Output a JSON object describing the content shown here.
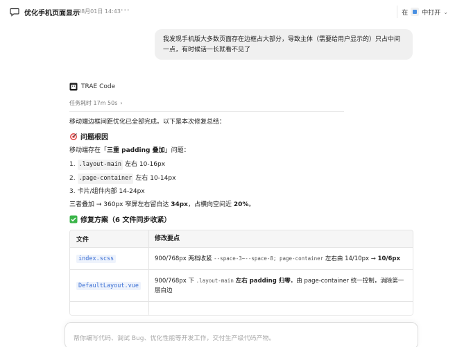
{
  "topbar": {
    "title": "优化手机页面显示",
    "date": "08月01日 14:43",
    "more": "···",
    "open_in_prefix": "在",
    "open_in_label": "中打开",
    "open_in_chevron": "⌄"
  },
  "user_message": "我发现手机版大多数页面存在边框占大部分，导致主体（需要给用户显示的）只占中间一点，有时候话一长就看不见了",
  "assistant": {
    "name": "TRAE Code",
    "duration": "任务耗时 17m 50s",
    "duration_chevron": "›",
    "summary": "移动端边框间距优化已全部完成。以下是本次修复总结：",
    "section1_title": "问题根因",
    "problem_prefix": "移动端存在「",
    "problem_bold": "三重 padding 叠加",
    "problem_suffix": "」问题：",
    "causes": [
      {
        "num": "1.",
        "code": ".layout-main",
        "text": " 左右 10-16px"
      },
      {
        "num": "2.",
        "code": ".page-container",
        "text": " 左右 10-14px"
      },
      {
        "num": "3.",
        "code": "",
        "text": "卡片/组件内部 14-24px"
      }
    ],
    "stack_prefix": "三者叠加 → 360px 窄屏左右留白达 ",
    "stack_bold1": "34px",
    "stack_mid": "，占横向空间近 ",
    "stack_bold2": "20%",
    "stack_suffix": "。",
    "section2_title": "修复方案（6 文件同步收紧）",
    "table": {
      "headers": [
        "文件",
        "修改要点"
      ],
      "rows": [
        {
          "file": "index.scss",
          "p1": "900/768px 两档收紧 ",
          "m1": "--space-3~--space-8; page-container",
          "p2": " 左右由 14/10px → ",
          "b1": "10/6px"
        },
        {
          "file": "DefaultLayout.vue",
          "p1": "900/768px 下 ",
          "m1": ".layout-main",
          "b1": " 左右 padding 归零",
          "p2": "，由 page-container 统一控制，消除第一层白边"
        },
        {
          "file": "",
          "p1": "",
          "m1": "",
          "b1": "",
          "p2": ""
        }
      ]
    }
  },
  "composer": {
    "placeholder": "帮你编写代码、调试 Bug、优化性能等开发工作，交付生产级代码产物。"
  }
}
